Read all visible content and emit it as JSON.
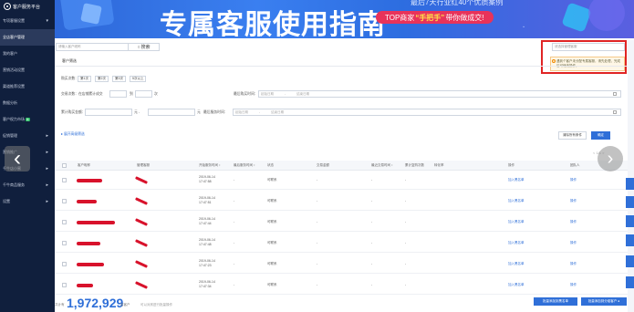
{
  "sidebar": {
    "title": "客户服务平台",
    "items": [
      {
        "label": "专项客服设置",
        "arrow": "▾"
      },
      {
        "label": "全店客户管理",
        "arrow": ""
      },
      {
        "label": "我的客户",
        "arrow": ""
      },
      {
        "label": "营销活动设置",
        "arrow": ""
      },
      {
        "label": "渠道推荐设置",
        "arrow": ""
      },
      {
        "label": "数据分析",
        "arrow": ""
      },
      {
        "label": "客户权力市场",
        "badge": "新",
        "arrow": ""
      },
      {
        "label": "促销管理",
        "arrow": "▸"
      },
      {
        "label": "营销推广",
        "arrow": "▸"
      },
      {
        "label": "千牛店小蜜",
        "arrow": "▸"
      },
      {
        "label": "千牛商品服务",
        "arrow": "▸"
      },
      {
        "label": "设置",
        "arrow": "▸"
      }
    ]
  },
  "banner": {
    "title": "专属客服使用指南",
    "pill_prefix": "TOP商家",
    "pill_highlight": "“手把手”",
    "pill_suffix": "带你做成交!",
    "top_text": "最后7天行业红40个优质案例"
  },
  "topbar": {
    "search_placeholder": "请输入客户昵称",
    "search_label": "搜索",
    "right_select": "请选择管理客服",
    "tip": "遇到个客户未分配专属客服，请先处理，完成后可继续操作。"
  },
  "filters": {
    "crumb": "客户筛选",
    "buy_times_label": "购买次数：",
    "buy_tags": [
      "第1次",
      "第2次",
      "第3次",
      "5次以上"
    ],
    "trade_label": "交易次数：在店铺累计成交",
    "trade_to": "到",
    "trade_unit": "次",
    "last_buy_label": "最后购买时间：",
    "start_date": "起始日期",
    "dash": "-",
    "end_date": "结束日期",
    "amount_label": "累计购买金额：",
    "yuan_to": "元 -",
    "yuan": "元",
    "last_service_label": "最后服务时间：",
    "expand_link": "▸ 展开高级筛选",
    "clear_label": "清除所有条件",
    "confirm_label": "确定"
  },
  "table": {
    "headers": [
      "客户昵称",
      "管理客服",
      "开始服务时间 ↕",
      "最后服务时间 ↕",
      "状态",
      "交易金额",
      "最近交易时间 ↕",
      "累计复购次数",
      "转化率",
      "操作",
      "团队人"
    ],
    "rows": [
      {
        "time": "2019-06-14 17:47:58",
        "dash": "-",
        "status": "可联系",
        "amount": "-",
        "last": "-",
        "count": "-",
        "action": "加入黑名单",
        "op": "操作"
      },
      {
        "time": "2019-06-14 17:47:51",
        "dash": "-",
        "status": "可联系",
        "amount": "-",
        "last": "-",
        "count": "-",
        "action": "加入黑名单",
        "op": "操作"
      },
      {
        "time": "2019-06-14 17:47:44",
        "dash": "-",
        "status": "可联系",
        "amount": "-",
        "last": "-",
        "count": "-",
        "action": "加入黑名单",
        "op": "操作"
      },
      {
        "time": "2019-06-14 17:47:48",
        "dash": "-",
        "status": "可联系",
        "amount": "-",
        "last": "-",
        "count": "-",
        "action": "加入黑名单",
        "op": "操作"
      },
      {
        "time": "2019-06-14 17:47:23",
        "dash": "-",
        "status": "可联系",
        "amount": "-",
        "last": "-",
        "count": "-",
        "action": "加入黑名单",
        "op": "操作"
      },
      {
        "time": "2019-06-14 17:47:34",
        "dash": "-",
        "status": "可联系",
        "amount": "-",
        "last": "-",
        "count": "-",
        "action": "加入黑名单",
        "op": "操作"
      }
    ]
  },
  "footer": {
    "count_label": "共计有",
    "count": "1,972,929",
    "count_tail": "名客户",
    "count_note": "可以对其进行批量操作",
    "btn_blacklist": "批量添加到黑名单",
    "btn_group": "批量添加到分组客户 ●"
  },
  "nav": {
    "prev": "‹",
    "next": "›",
    "pager": "< 1/1 >"
  },
  "colors": {
    "accent": "#2f6fd8",
    "sidebar": "#101f3d",
    "alert": "#e02424"
  }
}
